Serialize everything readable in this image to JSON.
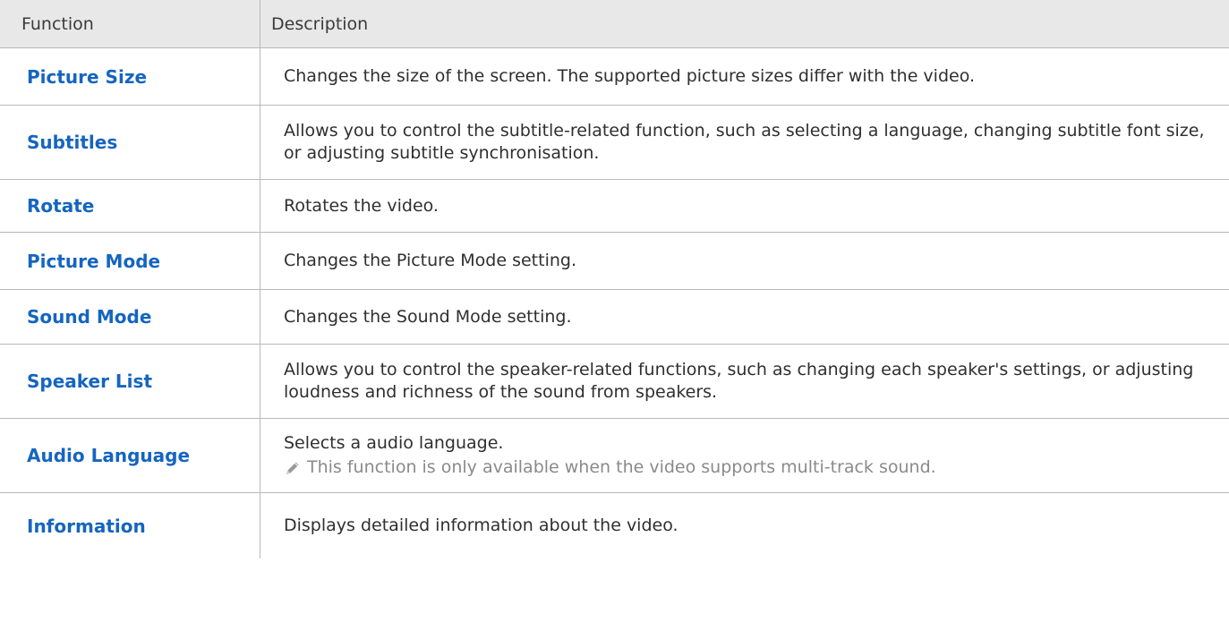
{
  "header": {
    "function_label": "Function",
    "description_label": "Description"
  },
  "rows": [
    {
      "function": "Picture Size",
      "description": "Changes the size of the screen. The supported picture sizes differ with the video."
    },
    {
      "function": "Subtitles",
      "description": "Allows you to control the subtitle-related function, such as selecting a language, changing subtitle font size, or adjusting subtitle synchronisation."
    },
    {
      "function": "Rotate",
      "description": "Rotates the video."
    },
    {
      "function": "Picture Mode",
      "description": "Changes the Picture Mode setting."
    },
    {
      "function": "Sound Mode",
      "description": "Changes the Sound Mode setting."
    },
    {
      "function": "Speaker List",
      "description": "Allows you to control the speaker-related functions, such as changing each speaker's settings, or adjusting loudness and richness of the sound from speakers."
    },
    {
      "function": "Audio Language",
      "description": "Selects a audio language.",
      "note": "This function is only available when the video supports multi-track sound.",
      "note_icon": "pencil-icon"
    },
    {
      "function": "Information",
      "description": "Displays detailed information about the video."
    }
  ],
  "colors": {
    "function_text": "#1565c0",
    "header_bg": "#e8e8e8",
    "note_text": "#8a8a8a"
  }
}
